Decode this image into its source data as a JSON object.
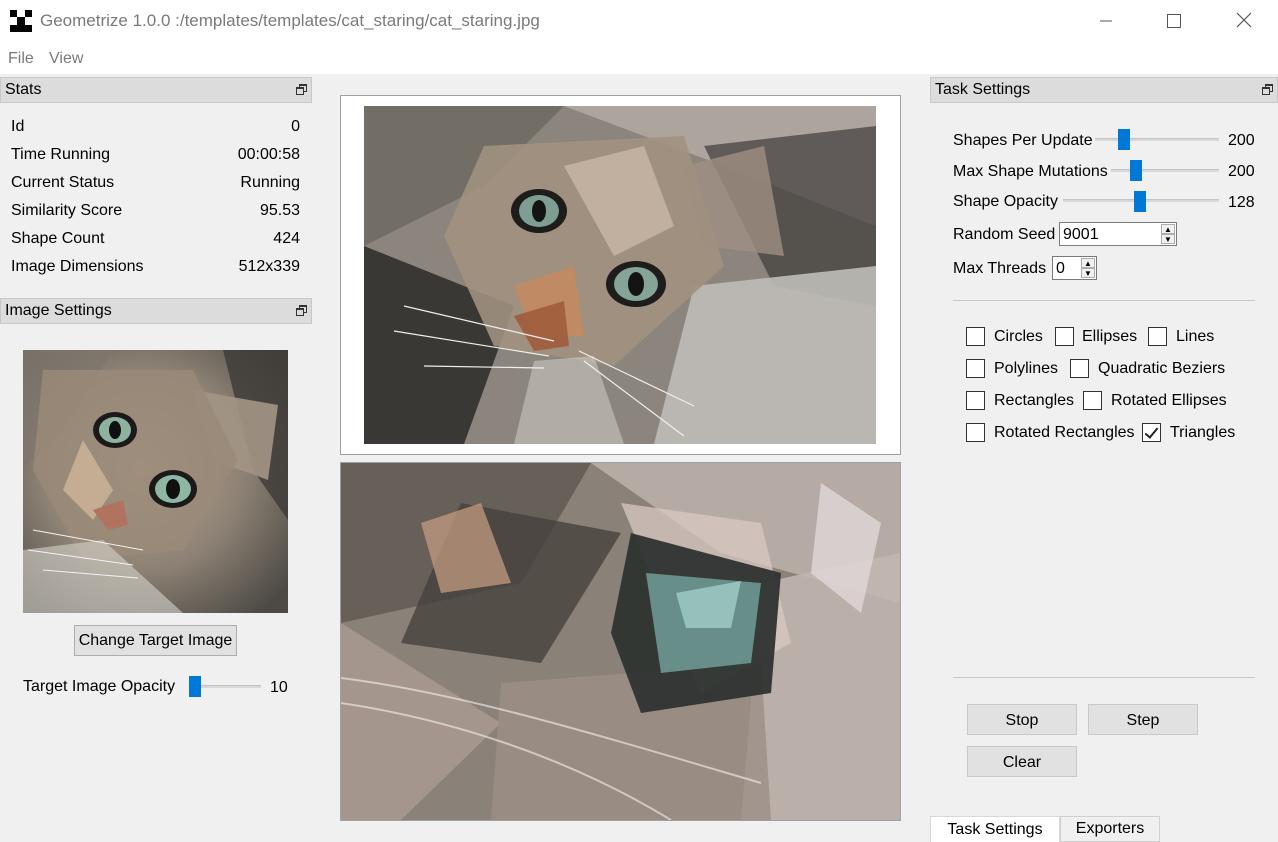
{
  "window": {
    "title": "Geometrize 1.0.0 :/templates/templates/cat_staring/cat_staring.jpg",
    "minimize_icon": "minimize-icon",
    "maximize_icon": "maximize-icon",
    "close_icon": "close-icon"
  },
  "menu": {
    "file": "File",
    "view": "View"
  },
  "stats": {
    "title": "Stats",
    "rows": [
      {
        "key": "Id",
        "value": "0"
      },
      {
        "key": "Time Running",
        "value": "00:00:58"
      },
      {
        "key": "Current Status",
        "value": "Running"
      },
      {
        "key": "Similarity Score",
        "value": "95.53"
      },
      {
        "key": "Shape Count",
        "value": "424"
      },
      {
        "key": "Image Dimensions",
        "value": "512x339"
      }
    ]
  },
  "image_settings": {
    "title": "Image Settings",
    "change_target_label": "Change Target Image",
    "opacity_label": "Target Image Opacity",
    "opacity_value": "10"
  },
  "task_settings": {
    "title": "Task Settings",
    "shapes_per_update": {
      "label": "Shapes Per Update",
      "value": "200"
    },
    "max_shape_mutations": {
      "label": "Max Shape Mutations",
      "value": "200"
    },
    "shape_opacity": {
      "label": "Shape Opacity",
      "value": "128"
    },
    "random_seed": {
      "label": "Random Seed",
      "value": "9001"
    },
    "max_threads": {
      "label": "Max Threads",
      "value": "0"
    },
    "shape_types": [
      {
        "label": "Circles",
        "checked": false
      },
      {
        "label": "Ellipses",
        "checked": false
      },
      {
        "label": "Lines",
        "checked": false
      },
      {
        "label": "Polylines",
        "checked": false
      },
      {
        "label": "Quadratic Beziers",
        "checked": false
      },
      {
        "label": "Rectangles",
        "checked": false
      },
      {
        "label": "Rotated Ellipses",
        "checked": false
      },
      {
        "label": "Rotated Rectangles",
        "checked": false
      },
      {
        "label": "Triangles",
        "checked": true
      }
    ],
    "stop_label": "Stop",
    "step_label": "Step",
    "clear_label": "Clear"
  },
  "tabs": {
    "task_settings": "Task Settings",
    "exporters": "Exporters"
  },
  "colors": {
    "accent": "#0078d7",
    "dock_title_bg": "#dcdcdc",
    "window_bg": "#f0f0f0"
  }
}
